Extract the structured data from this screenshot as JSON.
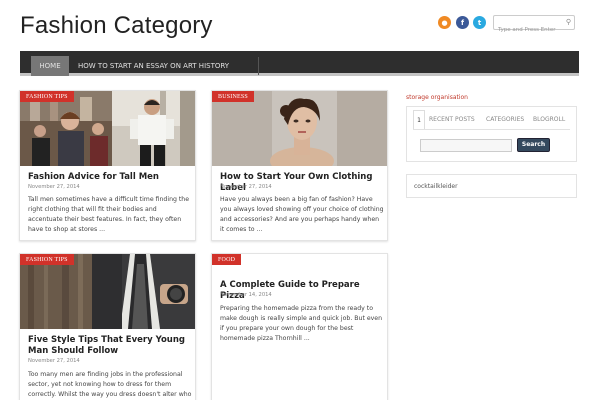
{
  "site": {
    "title": "Fashion Category"
  },
  "header": {
    "social": {
      "rss_glyph": "●",
      "facebook_glyph": "f",
      "twitter_glyph": "t"
    },
    "search_placeholder": "Type and Press Enter",
    "search_icon": "magnifier"
  },
  "nav": {
    "items": [
      {
        "label": "HOME",
        "active": true
      },
      {
        "label": "HOW TO START AN ESSAY ON ART HISTORY",
        "active": false
      }
    ]
  },
  "posts": [
    {
      "category": "FASHION TIPS",
      "title": "Fashion Advice for Tall Men",
      "date": "November 27, 2014",
      "excerpt": "Tall men sometimes have a difficult time finding the right clothing that will fit their bodies and accentuate their best features. In fact, they often have to shop at stores ..."
    },
    {
      "category": "BUSINESS",
      "title": "How to Start Your Own Clothing Label",
      "date": "November 27, 2014",
      "excerpt": "Have you always been a big fan of fashion? Have you always loved showing off your choice of clothing and accessories? And are you perhaps handy when it comes to ..."
    },
    {
      "category": "FASHION TIPS",
      "title": "Five Style Tips That Every Young Man Should Follow",
      "date": "November 27, 2014",
      "excerpt": "Too many men are finding jobs in the professional sector, yet not knowing how to dress for them correctly.  Whilst the way you dress doesn't alter who you are, it ..."
    },
    {
      "category": "FOOD",
      "title": "A Complete Guide to Prepare Pizza",
      "date": "November 14, 2014",
      "excerpt": "Preparing the homemade pizza from the ready to make dough is really simple and quick job. But even if you prepare your own dough for the best homemade pizza Thornhill ..."
    }
  ],
  "sidebar": {
    "widget_title": "storage organisation",
    "tabs": [
      "1",
      "RECENT POSTS",
      "CATEGORIES",
      "BLOGROLL"
    ],
    "search_button": "Search",
    "category_link": "cocktailkleider"
  },
  "colors": {
    "accent": "#d1322a",
    "nav_bg": "#2e2e2e",
    "button": "#34495e"
  }
}
